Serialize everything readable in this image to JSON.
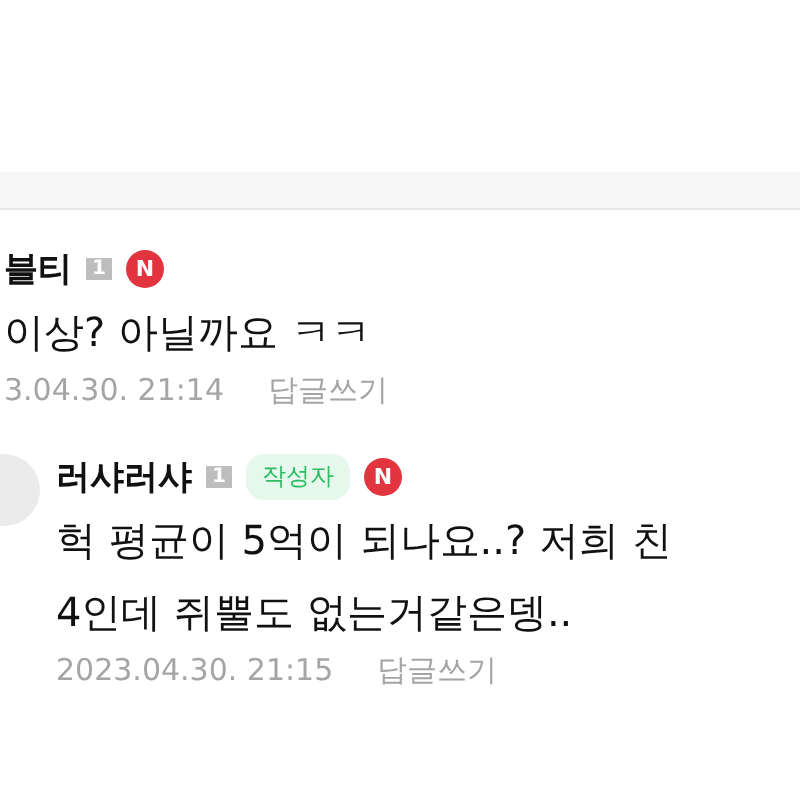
{
  "comments": [
    {
      "author": "블티",
      "level": "1",
      "is_writer": false,
      "is_new": true,
      "new_label": "N",
      "reply": false,
      "lines": [
        "이상? 아닐까요 ㅋㅋ"
      ],
      "date": "3.04.30. 21:14",
      "reply_link": "답글쓰기"
    },
    {
      "author": "러샤러샤",
      "level": "1",
      "is_writer": true,
      "writer_label": "작성자",
      "is_new": true,
      "new_label": "N",
      "reply": true,
      "lines": [
        "헉 평균이 5억이 되나요..? 저희 친",
        "4인데 쥐뿔도 없는거같은뎅.."
      ],
      "date": "2023.04.30. 21:15",
      "reply_link": "답글쓰기"
    }
  ]
}
